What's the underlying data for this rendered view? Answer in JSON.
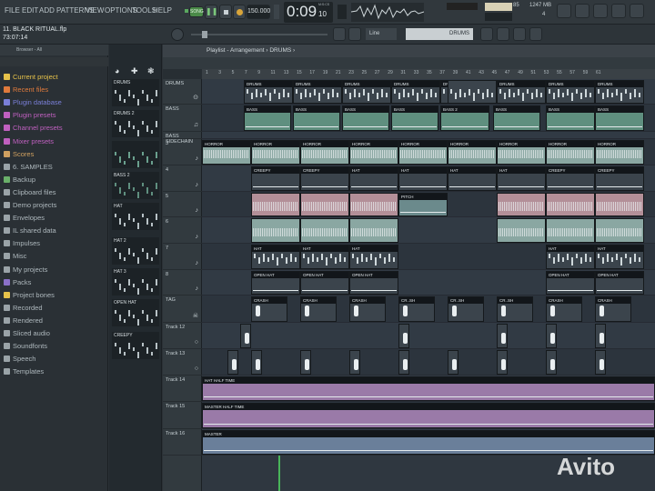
{
  "menu": [
    "FILE",
    "EDIT",
    "ADD",
    "PATTERNS",
    "VIEW",
    "OPTIONS",
    "TOOLS",
    "HELP"
  ],
  "transport": {
    "mode": "SONG",
    "tempo": "150.000",
    "time": "0:09",
    "time_sub": "10",
    "time_unit": "M:S:CS"
  },
  "monitor": {
    "memory": "1247 MB",
    "cpu": "85",
    "voices": "4"
  },
  "hint": {
    "project": "11. BLACK RITUAL.flp",
    "time": "73:07:14",
    "snap": "Line",
    "pattern": "DRUMS"
  },
  "browser": {
    "header": "Browser - All",
    "items": [
      {
        "label": "Current project",
        "color": "#e6c24a"
      },
      {
        "label": "Recent files",
        "color": "#e07a3c"
      },
      {
        "label": "Plugin database",
        "color": "#7a7fd8"
      },
      {
        "label": "Plugin presets",
        "color": "#c060c0"
      },
      {
        "label": "Channel presets",
        "color": "#c060c0"
      },
      {
        "label": "Mixer presets",
        "color": "#c060c0"
      },
      {
        "label": "Scores",
        "color": "#d0a060"
      },
      {
        "label": "6. SAMPLES",
        "color": "#9aa3a8"
      },
      {
        "label": "Backup",
        "color": "#6ab06a"
      },
      {
        "label": "Clipboard files",
        "color": "#9aa3a8"
      },
      {
        "label": "Demo projects",
        "color": "#9aa3a8"
      },
      {
        "label": "Envelopes",
        "color": "#9aa3a8"
      },
      {
        "label": "IL shared data",
        "color": "#9aa3a8"
      },
      {
        "label": "Impulses",
        "color": "#9aa3a8"
      },
      {
        "label": "Misc",
        "color": "#9aa3a8"
      },
      {
        "label": "My projects",
        "color": "#9aa3a8"
      },
      {
        "label": "Packs",
        "color": "#8a70c8"
      },
      {
        "label": "Project bones",
        "color": "#e6c24a"
      },
      {
        "label": "Recorded",
        "color": "#9aa3a8"
      },
      {
        "label": "Rendered",
        "color": "#9aa3a8"
      },
      {
        "label": "Sliced audio",
        "color": "#9aa3a8"
      },
      {
        "label": "Soundfonts",
        "color": "#9aa3a8"
      },
      {
        "label": "Speech",
        "color": "#9aa3a8"
      },
      {
        "label": "Templates",
        "color": "#9aa3a8"
      }
    ]
  },
  "rack": [
    "DRUMS",
    "DRUMS 2",
    "",
    "BASS 2",
    "HAT",
    "HAT 2",
    "HAT 3",
    "OPEN HAT",
    "CREEPY"
  ],
  "playlist": {
    "title": "Playlist - Arrangement › DRUMS ›",
    "ruler": [
      "1",
      "3",
      "5",
      "7",
      "9",
      "11",
      "13",
      "15",
      "17",
      "19",
      "21",
      "23",
      "25",
      "27",
      "29",
      "31",
      "33",
      "35",
      "37",
      "39",
      "41",
      "43",
      "45",
      "47",
      "49",
      "51",
      "53",
      "55",
      "57",
      "59",
      "61"
    ],
    "tracks": [
      "DRUMS",
      "BASS",
      "BASS SIDECHAIN",
      "3",
      "4",
      "5",
      "6",
      "7",
      "8",
      "TAG",
      "Track 12",
      "Track 13",
      "Track 14",
      "Track 15",
      "Track 16"
    ],
    "clip_names": {
      "drums": "DRUMS",
      "bass": "BASS",
      "bass2": "BASS 2",
      "horror": "HORROR",
      "creepy": "CREEPY",
      "hat": "HAT",
      "hat3": "HAT 3",
      "pitch": "PITCH",
      "openhat": "OPEN HAT",
      "crash": "CRASH",
      "crashshort": "CR..SH",
      "hathalf": "HAT HALF TIME",
      "masterhalf": "MASTER HALF TIME",
      "master": "MASTER"
    }
  },
  "watermark": "Avito",
  "colors": {
    "clip_green": "#5f8f7f",
    "clip_pale": "#8aa7a2",
    "clip_pink": "#b38f98",
    "automation": "#9a7aa8",
    "accent_green": "#49b55a"
  }
}
